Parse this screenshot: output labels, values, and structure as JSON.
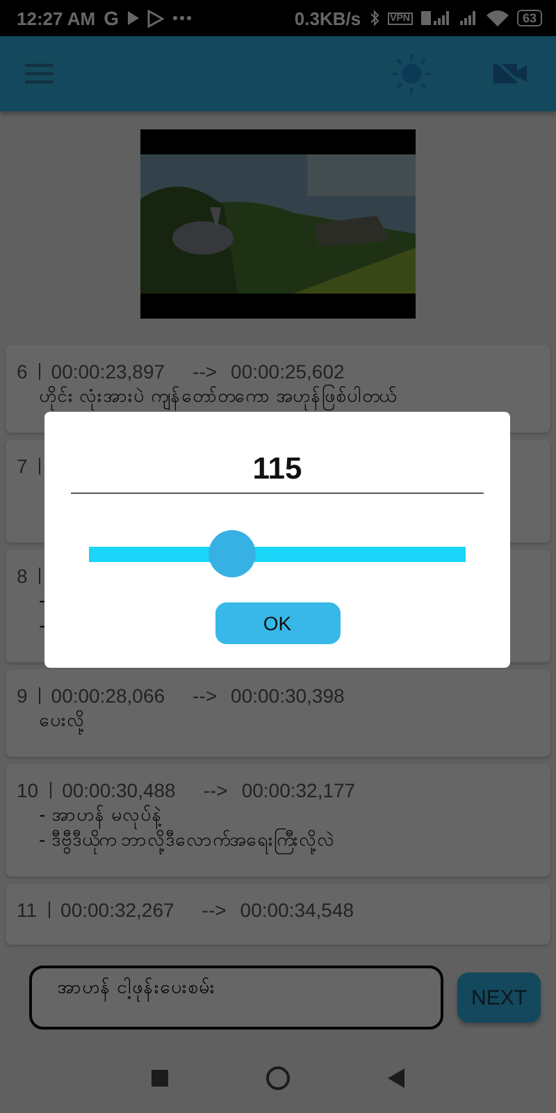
{
  "status_bar": {
    "time": "12:27 AM",
    "carrier_icon": "G",
    "speed": "0.3KB/s",
    "vpn": "VPN",
    "battery": "63"
  },
  "subtitles": [
    {
      "index": "6",
      "start": "00:00:23,897",
      "arrow": "-->",
      "end": "00:00:25,602",
      "lines": [
        "ဟိုင်း လုံးအားပဲ ကျန်တော်တကော အဟုန်ဖြစ်ပါတယ်"
      ]
    },
    {
      "index": "7"
    },
    {
      "index": "8",
      "lines": [
        "-",
        "-"
      ]
    },
    {
      "index": "9",
      "start": "00:00:28,066",
      "arrow": "-->",
      "end": "00:00:30,398",
      "lines": [
        "ပေးလို့"
      ]
    },
    {
      "index": "10",
      "start": "00:00:30,488",
      "arrow": "-->",
      "end": "00:00:32,177",
      "lines": [
        "- အာဟန် မလုပ်နဲ့",
        "- ဒီဗွီဒီယိုက ဘာလို့ဒီလောက်အရေးကြီးလို့လဲ"
      ]
    },
    {
      "index": "11",
      "start": "00:00:32,267",
      "arrow": "-->",
      "end": "00:00:34,548"
    }
  ],
  "input": {
    "value": "အာဟန် ငါ့ဖုန်းပေးစမ်း"
  },
  "next_button": "NEXT",
  "dialog": {
    "value": "115",
    "level": 0.38,
    "button": "OK"
  }
}
